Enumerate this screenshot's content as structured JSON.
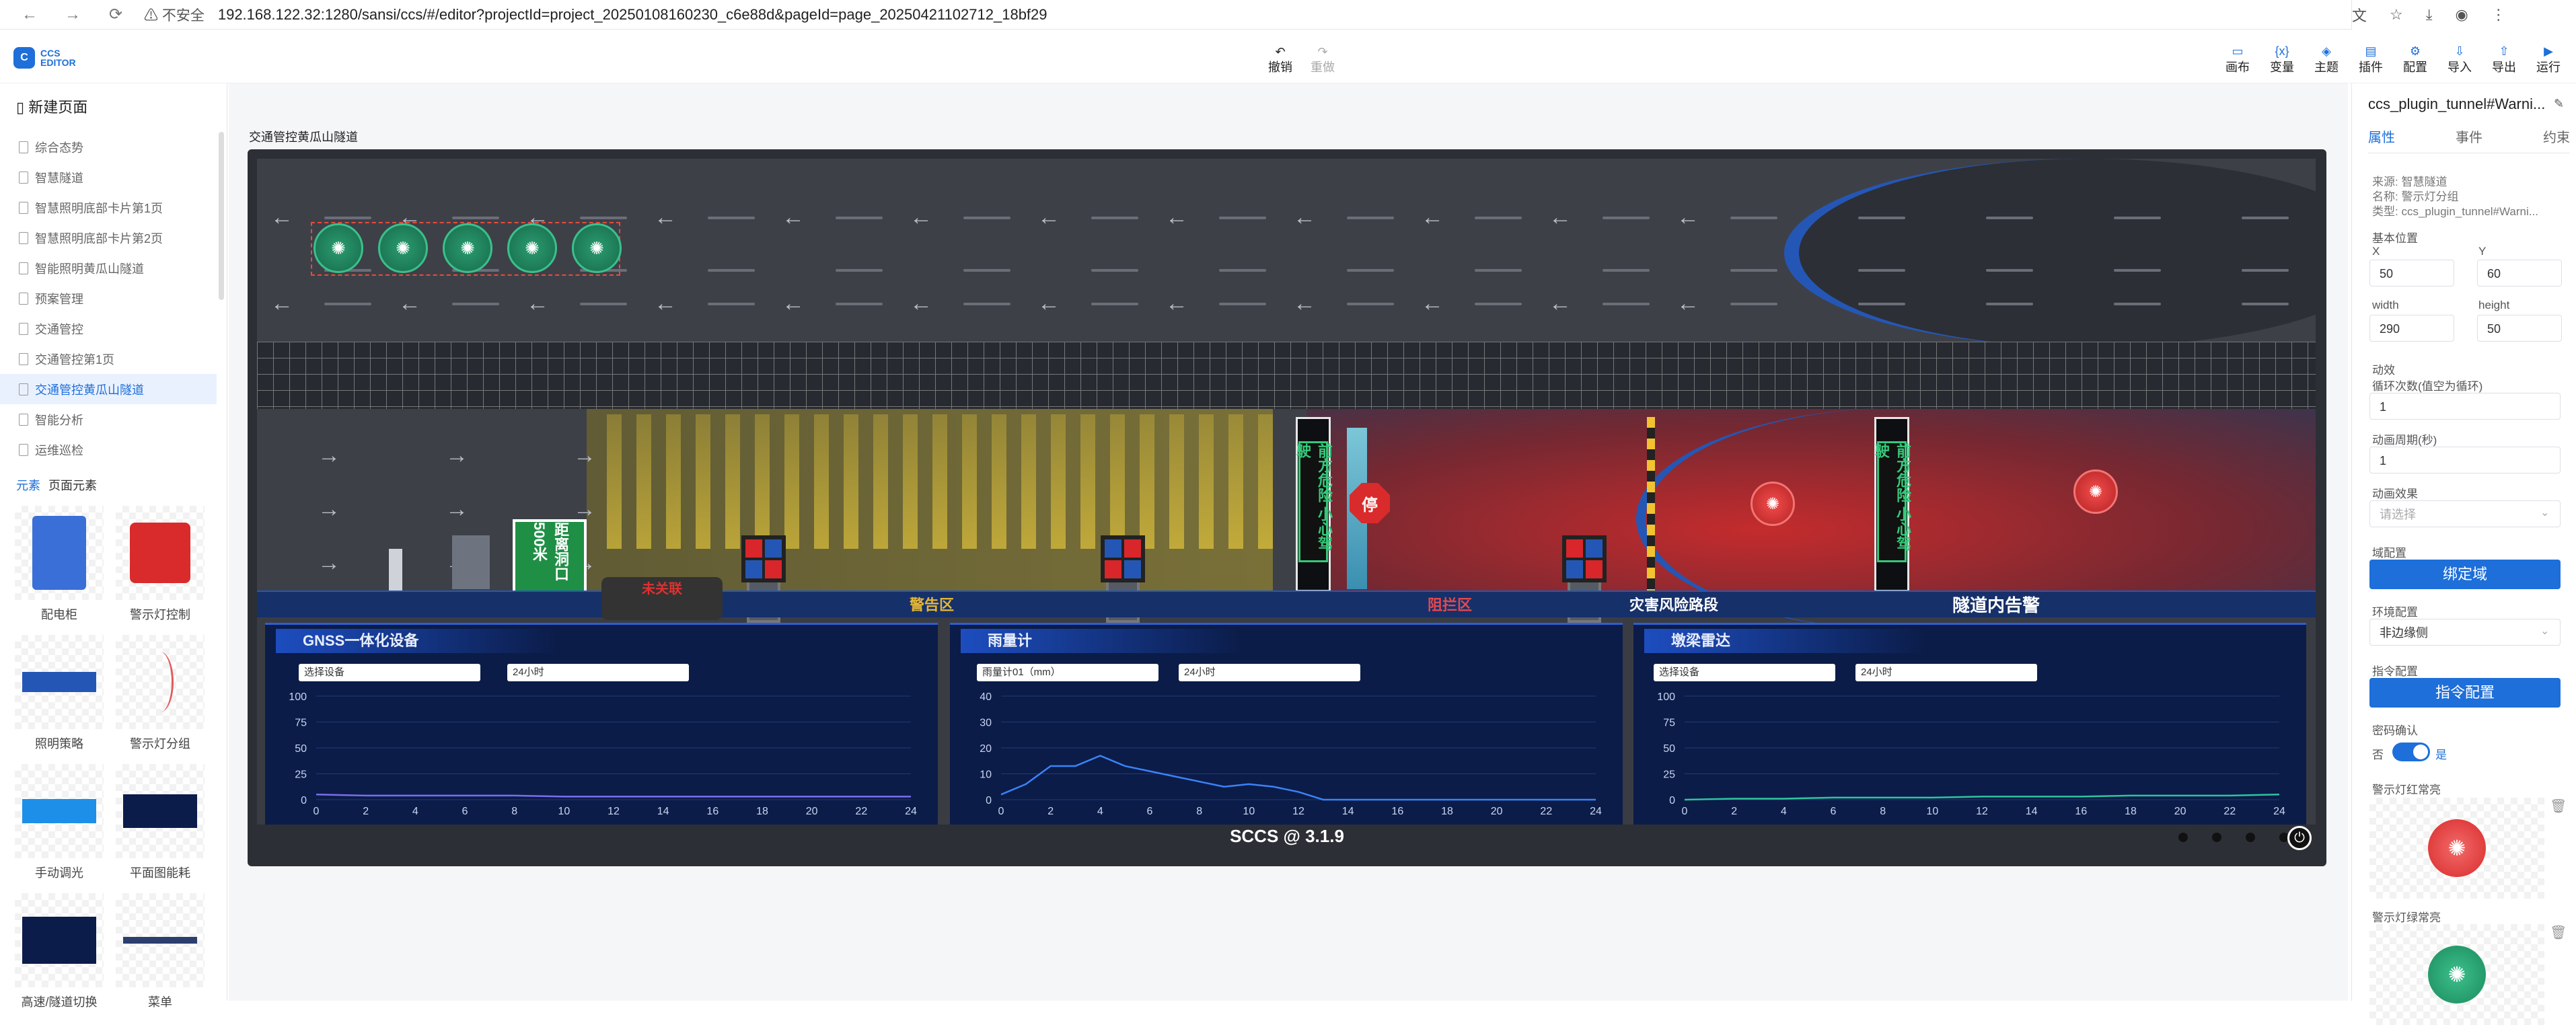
{
  "browser": {
    "back": "←",
    "forward": "→",
    "reload": "⟳",
    "insecure": "⚠ 不安全",
    "url": "192.168.122.32:1280/sansi/ccs/#/editor?projectId=project_20250108160230_c6e88d&pageId=page_20250421102712_18bf29"
  },
  "app": {
    "logo_mark": "C",
    "logo_line1": "CCS",
    "logo_line2": "EDITOR",
    "undo": "撤销",
    "redo": "重做",
    "tools": [
      {
        "icon": "▭",
        "label": "画布"
      },
      {
        "icon": "{x}",
        "label": "变量"
      },
      {
        "icon": "◈",
        "label": "主题"
      },
      {
        "icon": "▤",
        "label": "插件"
      },
      {
        "icon": "⚙",
        "label": "配置"
      },
      {
        "icon": "⇩",
        "label": "导入"
      },
      {
        "icon": "⇧",
        "label": "导出"
      },
      {
        "icon": "▶",
        "label": "运行"
      }
    ],
    "caret": "▾"
  },
  "sidebar": {
    "new_page": "新建页面",
    "pages": [
      "综合态势",
      "智慧隧道",
      "智慧照明底部卡片第1页",
      "智慧照明底部卡片第2页",
      "智能照明黄瓜山隧道",
      "预案管理",
      "交通管控",
      "交通管控第1页",
      "交通管控黄瓜山隧道",
      "智能分析",
      "运维巡检"
    ],
    "active_page": "交通管控黄瓜山隧道",
    "tab_elements": "元素",
    "tab_page_elements": "页面元素",
    "elements": [
      "配电柜",
      "警示灯控制",
      "照明策略",
      "警示灯分组",
      "手动调光",
      "平面图能耗",
      "高速/隧道切换",
      "菜单"
    ]
  },
  "canvas": {
    "breadcrumb": "交通管控黄瓜山隧道",
    "green_sign": "距离洞口500米",
    "tooltip": "未关联",
    "vms1": "前方危险 小心驾驶",
    "vms2": "前方危险 小心驾驶",
    "stop": "停",
    "zones": [
      "警告区",
      "阻拦区",
      "灾害风险路段",
      "隧道内告警"
    ],
    "footer": "SCCS @ 3.1.9",
    "panels": [
      {
        "title": "GNSS一体化设备",
        "sel1": "选择设备",
        "sel2": "24小时"
      },
      {
        "title": "雨量计",
        "sel1": "雨量计01（mm）",
        "sel2": "24小时"
      },
      {
        "title": "墩梁雷达",
        "sel1": "选择设备",
        "sel2": "24小时"
      }
    ]
  },
  "chart_data": [
    {
      "type": "line",
      "title": "GNSS一体化设备",
      "x": [
        0,
        2,
        4,
        6,
        8,
        10,
        12,
        14,
        16,
        18,
        20,
        22,
        24
      ],
      "ylim": [
        0,
        100
      ],
      "yticks": [
        0,
        25,
        50,
        75,
        100
      ],
      "series": [
        {
          "values": [
            5,
            4,
            4,
            4,
            4,
            3,
            3,
            3,
            3,
            3,
            3,
            3,
            3
          ]
        }
      ]
    },
    {
      "type": "line",
      "title": "雨量计",
      "x": [
        0,
        1,
        2,
        3,
        4,
        5,
        6,
        7,
        8,
        9,
        10,
        11,
        12,
        13,
        14,
        15,
        16,
        17,
        18,
        19,
        20,
        21,
        22,
        23,
        24
      ],
      "ylim": [
        0,
        40
      ],
      "yticks": [
        0,
        10,
        20,
        30,
        40
      ],
      "series": [
        {
          "values": [
            2,
            6,
            13,
            13,
            17,
            13,
            11,
            9,
            7,
            5,
            6,
            5,
            3,
            0,
            0,
            0,
            0,
            0,
            0,
            0,
            0,
            0,
            0,
            0,
            0
          ]
        }
      ]
    },
    {
      "type": "line",
      "title": "墩梁雷达",
      "x": [
        0,
        2,
        4,
        6,
        8,
        10,
        12,
        14,
        16,
        18,
        20,
        22,
        24
      ],
      "ylim": [
        0,
        100
      ],
      "yticks": [
        0,
        25,
        50,
        75,
        100
      ],
      "series": [
        {
          "values": [
            0,
            1,
            1,
            2,
            2,
            2,
            3,
            3,
            3,
            4,
            4,
            4,
            5
          ]
        }
      ]
    }
  ],
  "props": {
    "title": "ccs_plugin_tunnel#Warni...",
    "tabs": [
      "属性",
      "事件",
      "约束"
    ],
    "source": "来源: 智慧隧道",
    "name": "名称: 警示灯分组",
    "type": "类型: ccs_plugin_tunnel#Warni...",
    "base_pos": "基本位置",
    "x_label": "X",
    "x": "50",
    "y_label": "Y",
    "y": "60",
    "w_label": "width",
    "w": "290",
    "h_label": "height",
    "h": "50",
    "anim": "动效",
    "loop_label": "循环次数(值空为循环)",
    "loop": "1",
    "period_label": "动画周期(秒)",
    "period": "1",
    "effect_label": "动画效果",
    "effect_ph": "请选择",
    "domain_label": "域配置",
    "domain_btn": "绑定域",
    "env_label": "环境配置",
    "env": "非边缘侧",
    "cmd_label": "指令配置",
    "cmd_btn": "指令配置",
    "pwd_label": "密码确认",
    "no": "否",
    "yes": "是",
    "red_label": "警示灯红常亮",
    "green_label": "警示灯绿常亮"
  }
}
